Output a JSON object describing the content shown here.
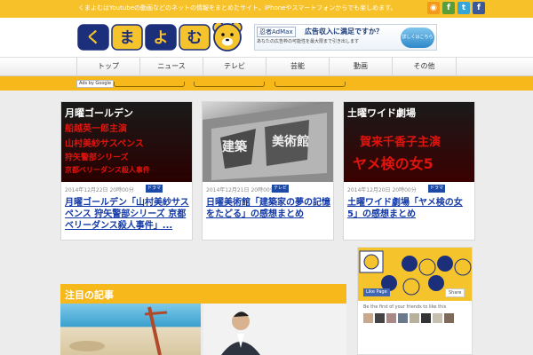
{
  "topbar": {
    "tagline": "くまよむはYoutubeの動画などのネットの情報をまとめたサイト。iPhoneやスマートフォンからでも楽しめます。",
    "social": [
      {
        "name": "rss-icon",
        "glyph": "◉",
        "color": "#f39a1b"
      },
      {
        "name": "feedly-icon",
        "glyph": "f",
        "color": "#5a9e3a"
      },
      {
        "name": "twitter-icon",
        "glyph": "t",
        "color": "#36a6d8"
      },
      {
        "name": "facebook-icon",
        "glyph": "f",
        "color": "#3b5998"
      }
    ]
  },
  "logo": {
    "chars": [
      "く",
      "ま",
      "よ",
      "む"
    ]
  },
  "ad": {
    "brand": "忍者AdMax",
    "headline": "広告収入に満足ですか？",
    "sub": "あなたの広告枠の可能性を最大限まで引き出します",
    "button": "詳しくはこちら"
  },
  "nav": {
    "items": [
      "トップ",
      "ニュース",
      "テレビ",
      "芸能",
      "動画",
      "その他"
    ]
  },
  "adsbar": {
    "label": "Ads by Google"
  },
  "cards": [
    {
      "image_lines": [
        "月曜ゴールデン",
        "船越英一郎主演",
        "山村美紗サスペンス",
        "狩矢警部シリーズ",
        "京都ベリーダンス殺人事件"
      ],
      "date": "2014年12月22日 20時00分",
      "category": "ドラマ",
      "title": "月曜ゴールデン「山村美紗サスペンス 狩矢警部シリーズ 京都ベリーダンス殺人事件」..."
    },
    {
      "image_lines": [
        "建築",
        "美術館"
      ],
      "date": "2014年12月21日 20時00分",
      "category": "テレビ",
      "title": "日曜美術館「建築家の夢の記憶をたどる」の感想まとめ"
    },
    {
      "image_lines": [
        "土曜ワイド劇場",
        "賀来千香子主演",
        "ヤメ検の女5"
      ],
      "date": "2014年12月20日 20時00分",
      "category": "ドラマ",
      "title": "土曜ワイド劇場「ヤメ検の女5」の感想まとめ"
    }
  ],
  "section": {
    "title": "注目の記事"
  },
  "widget": {
    "like_button": "Like Page",
    "share_button": "Share",
    "friends_text": "Be the first of your friends to like this"
  }
}
